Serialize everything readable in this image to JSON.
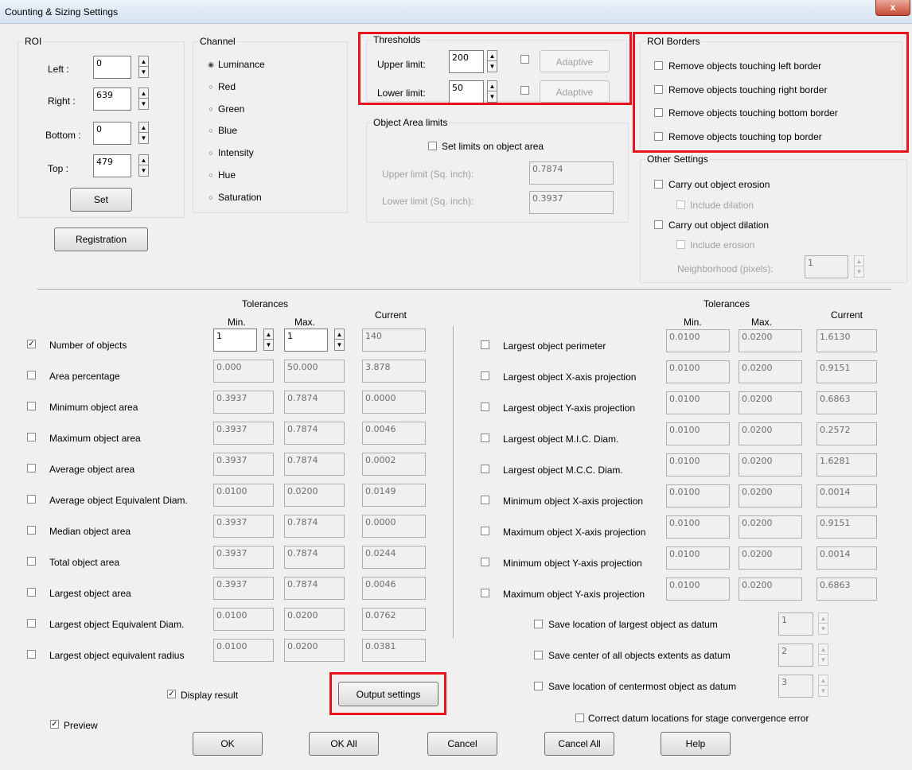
{
  "window": {
    "title": "Counting & Sizing Settings",
    "close_glyph": "x"
  },
  "roi": {
    "title": "ROI",
    "left_label": "Left   :",
    "left_value": "0",
    "right_label": "Right  :",
    "right_value": "639",
    "bottom_label": "Bottom :",
    "bottom_value": "0",
    "top_label": "Top   :",
    "top_value": "479",
    "set_label": "Set",
    "registration_label": "Registration"
  },
  "channel": {
    "title": "Channel",
    "options": [
      "Luminance",
      "Red",
      "Green",
      "Blue",
      "Intensity",
      "Hue",
      "Saturation"
    ],
    "selected": "Luminance"
  },
  "thresholds": {
    "title": "Thresholds",
    "upper_label": "Upper limit:",
    "upper_value": "200",
    "lower_label": "Lower limit:",
    "lower_value": "50",
    "adaptive_label": "Adaptive"
  },
  "area_limits": {
    "title": "Object Area limits",
    "set_limits_label": "Set limits on object area",
    "upper_label": "Upper limit (Sq. inch):",
    "upper_value": "0.7874",
    "lower_label": "Lower limit (Sq. inch):",
    "lower_value": "0.3937"
  },
  "roi_borders": {
    "title": "ROI Borders",
    "options": [
      "Remove objects touching left border",
      "Remove objects touching right border",
      "Remove objects touching bottom border",
      "Remove objects touching top border"
    ]
  },
  "other": {
    "title": "Other Settings",
    "erosion_label": "Carry out object erosion",
    "include_dilation_label": "Include dilation",
    "dilation_label": "Carry out object dilation",
    "include_erosion_label": "Include erosion",
    "neighborhood_label": "Neighborhood (pixels):",
    "neighborhood_value": "1"
  },
  "headers": {
    "tolerances": "Tolerances",
    "min": "Min.",
    "max": "Max.",
    "current": "Current"
  },
  "left_rows": [
    {
      "label": "Number of objects",
      "min": "1",
      "max": "1",
      "current": "140",
      "checked": true
    },
    {
      "label": "Area percentage",
      "min": "0.000",
      "max": "50.000",
      "current": "3.878",
      "checked": false
    },
    {
      "label": "Minimum object area",
      "min": "0.3937",
      "max": "0.7874",
      "current": "0.0000",
      "checked": false
    },
    {
      "label": "Maximum object area",
      "min": "0.3937",
      "max": "0.7874",
      "current": "0.0046",
      "checked": false
    },
    {
      "label": "Average object area",
      "min": "0.3937",
      "max": "0.7874",
      "current": "0.0002",
      "checked": false
    },
    {
      "label": "Average object Equivalent Diam.",
      "min": "0.0100",
      "max": "0.0200",
      "current": "0.0149",
      "checked": false
    },
    {
      "label": "Median object area",
      "min": "0.3937",
      "max": "0.7874",
      "current": "0.0000",
      "checked": false
    },
    {
      "label": "Total object area",
      "min": "0.3937",
      "max": "0.7874",
      "current": "0.0244",
      "checked": false
    },
    {
      "label": "Largest object area",
      "min": "0.3937",
      "max": "0.7874",
      "current": "0.0046",
      "checked": false
    },
    {
      "label": "Largest object Equivalent Diam.",
      "min": "0.0100",
      "max": "0.0200",
      "current": "0.0762",
      "checked": false
    },
    {
      "label": "Largest object equivalent radius",
      "min": "0.0100",
      "max": "0.0200",
      "current": "0.0381",
      "checked": false
    }
  ],
  "right_rows": [
    {
      "label": "Largest object perimeter",
      "min": "0.0100",
      "max": "0.0200",
      "current": "1.6130"
    },
    {
      "label": "Largest object X-axis projection",
      "min": "0.0100",
      "max": "0.0200",
      "current": "0.9151"
    },
    {
      "label": "Largest object Y-axis projection",
      "min": "0.0100",
      "max": "0.0200",
      "current": "0.6863"
    },
    {
      "label": "Largest object M.I.C. Diam.",
      "min": "0.0100",
      "max": "0.0200",
      "current": "0.2572"
    },
    {
      "label": "Largest object M.C.C. Diam.",
      "min": "0.0100",
      "max": "0.0200",
      "current": "1.6281"
    },
    {
      "label": "Minimum object X-axis projection",
      "min": "0.0100",
      "max": "0.0200",
      "current": "0.0014"
    },
    {
      "label": "Maximum object X-axis projection",
      "min": "0.0100",
      "max": "0.0200",
      "current": "0.9151"
    },
    {
      "label": "Minimum object Y-axis projection",
      "min": "0.0100",
      "max": "0.0200",
      "current": "0.0014"
    },
    {
      "label": "Maximum object Y-axis projection",
      "min": "0.0100",
      "max": "0.0200",
      "current": "0.6863"
    }
  ],
  "datum": [
    {
      "label": "Save location of largest object as datum",
      "value": "1"
    },
    {
      "label": "Save center of all objects extents as datum",
      "value": "2"
    },
    {
      "label": "Save location of centermost object as datum",
      "value": "3"
    }
  ],
  "correct_datum_label": "Correct datum locations for stage convergence error",
  "display_result_label": "Display result",
  "output_settings_label": "Output settings",
  "preview_label": "Preview",
  "buttons": {
    "ok": "OK",
    "ok_all": "OK All",
    "cancel": "Cancel",
    "cancel_all": "Cancel All",
    "help": "Help"
  },
  "colors": {
    "highlight": "#e8141d",
    "dialog_bg": "#f0f0f0"
  }
}
